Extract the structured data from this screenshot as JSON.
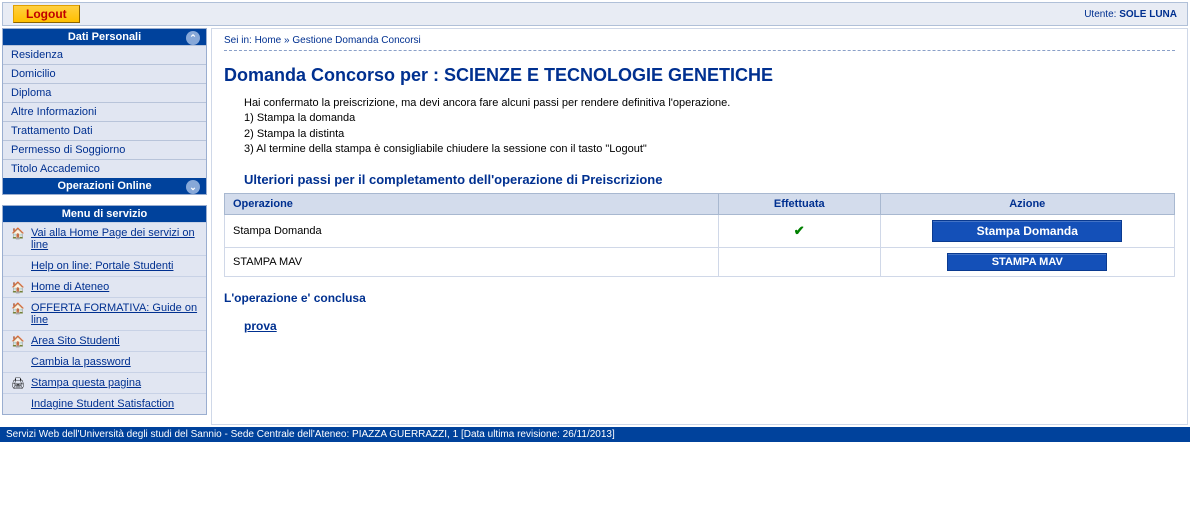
{
  "top": {
    "logout": "Logout",
    "user_prefix": "Utente:",
    "user_name": "SOLE LUNA"
  },
  "sidebar": {
    "p1": {
      "title": "Dati Personali",
      "items": [
        "Residenza",
        "Domicilio",
        "Diploma",
        "Altre Informazioni",
        "Trattamento Dati",
        "Permesso di Soggiorno",
        "Titolo Accademico"
      ]
    },
    "p2": {
      "title": "Operazioni Online"
    },
    "p3": {
      "title": "Menu di servizio",
      "items": [
        "Vai alla Home Page dei servizi on line",
        "Help on line: Portale Studenti",
        "Home di Ateneo",
        "OFFERTA FORMATIVA: Guide on line",
        "Area Sito Studenti",
        "Cambia la password",
        "Stampa questa pagina",
        "Indagine Student Satisfaction"
      ]
    }
  },
  "main": {
    "breadcrumb": "Sei in: Home » Gestione Domanda Concorsi",
    "title": "Domanda Concorso per : SCIENZE E TECNOLOGIE GENETICHE",
    "intro": "Hai confermato la preiscrizione, ma devi ancora fare alcuni passi per rendere definitiva l'operazione.",
    "step1": "1) Stampa la domanda",
    "step2": "2) Stampa la distinta",
    "step3": "3) Al termine della stampa è consigliabile chiudere la sessione con il tasto \"Logout\"",
    "sub": "Ulteriori passi per il completamento dell'operazione di Preiscrizione",
    "th_op": "Operazione",
    "th_done": "Effettuata",
    "th_action": "Azione",
    "rows": [
      {
        "op": "Stampa Domanda",
        "done": true,
        "action": "Stampa Domanda"
      },
      {
        "op": "STAMPA MAV",
        "done": false,
        "action": "STAMPA MAV"
      }
    ],
    "concluded": "L'operazione e' conclusa",
    "result": "prova"
  },
  "footer": "Servizi Web dell'Università degli studi del Sannio - Sede Centrale dell'Ateneo: PIAZZA GUERRAZZI, 1 [Data ultima revisione: 26/11/2013]"
}
